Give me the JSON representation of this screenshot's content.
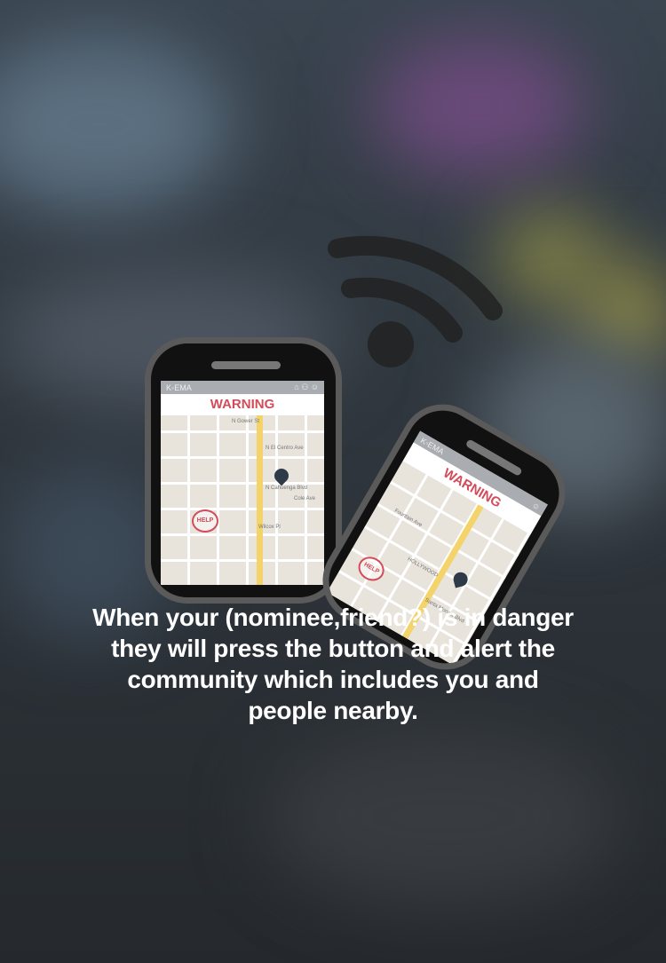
{
  "caption": {
    "lines": [
      "When your (nominee,friend?) is in danger",
      "they will press the button and alert the",
      "community which includes you and",
      "people nearby."
    ]
  },
  "phone_screen": {
    "title": "WARNING",
    "help_bubble": "HELP",
    "map_labels": [
      "N Gower St",
      "N El Centro Ave",
      "N Cahuenga Blvd",
      "Santa Monica Blvd",
      "Fountain Ave",
      "Wilcox Pl",
      "HOLLYWOOD",
      "Cole Ave"
    ],
    "icons": [
      "home-icon",
      "community-icon",
      "user-icon",
      "map-pin-icon"
    ]
  },
  "colors": {
    "warning": "#d24c5a",
    "caption": "#ffffff"
  }
}
